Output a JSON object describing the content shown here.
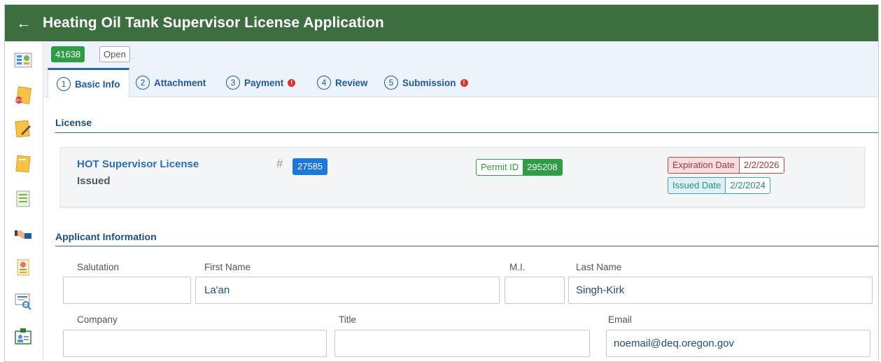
{
  "header": {
    "title": "Heating Oil Tank Supervisor License Application",
    "back_icon": "←"
  },
  "sidebar": {
    "items": [
      {
        "name": "dashboard-icon",
        "color": "#4a8fd6"
      },
      {
        "name": "new-application-icon",
        "color": "#f2a72c"
      },
      {
        "name": "edit-application-icon",
        "color": "#f2a72c"
      },
      {
        "name": "applications-icon",
        "color": "#f2a72c"
      },
      {
        "name": "list-icon",
        "color": "#7cb342"
      },
      {
        "name": "handshake-icon",
        "color": "#1e5aa0"
      },
      {
        "name": "certificate-icon",
        "color": "#f2a72c"
      },
      {
        "name": "search-certificate-icon",
        "color": "#3a7bd5"
      },
      {
        "name": "id-badge-icon",
        "color": "#2e7d32"
      }
    ]
  },
  "status": {
    "id": "41638",
    "state": "Open"
  },
  "tabs": [
    {
      "num": "1",
      "label": "Basic Info",
      "active": true,
      "alert": false
    },
    {
      "num": "2",
      "label": "Attachment",
      "active": false,
      "alert": false
    },
    {
      "num": "3",
      "label": "Payment",
      "active": false,
      "alert": true
    },
    {
      "num": "4",
      "label": "Review",
      "active": false,
      "alert": false
    },
    {
      "num": "5",
      "label": "Submission",
      "active": false,
      "alert": true
    }
  ],
  "license_section": {
    "heading": "License",
    "name": "HOT Supervisor License",
    "status": "Issued",
    "hash": "#",
    "number": "27585",
    "permit_label": "Permit ID",
    "permit_id": "295208",
    "expiration_label": "Expiration Date",
    "expiration_date": "2/2/2026",
    "issued_label": "Issued Date",
    "issued_date": "2/2/2024"
  },
  "applicant": {
    "heading": "Applicant Information",
    "salutation": {
      "label": "Salutation",
      "value": ""
    },
    "first_name": {
      "label": "First Name",
      "value": "La'an"
    },
    "mi": {
      "label": "M.I.",
      "value": ""
    },
    "last_name": {
      "label": "Last Name",
      "value": "Singh-Kirk"
    },
    "company": {
      "label": "Company",
      "value": ""
    },
    "title": {
      "label": "Title",
      "value": ""
    },
    "email": {
      "label": "Email",
      "value": "noemail@deq.oregon.gov"
    }
  },
  "colors": {
    "header_bg": "#3c6e3f",
    "accent_blue": "#2a6ec2",
    "green": "#2e9e45",
    "red": "#c34646",
    "teal": "#3aa3ad"
  }
}
